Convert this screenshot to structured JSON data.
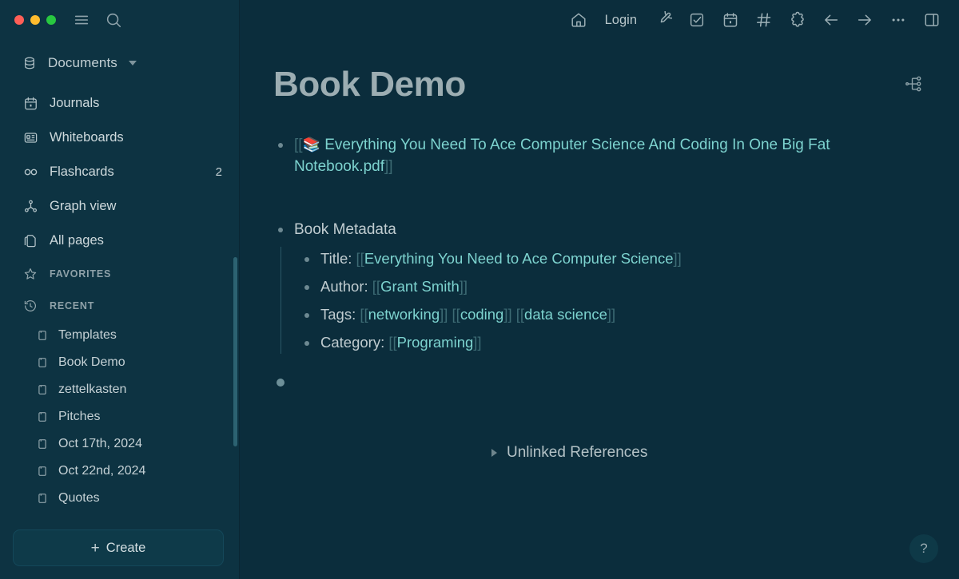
{
  "window": {
    "traffic_lights": [
      {
        "name": "close",
        "color": "#ff5f57"
      },
      {
        "name": "minimize",
        "color": "#febc2e"
      },
      {
        "name": "zoom",
        "color": "#28c840"
      }
    ],
    "menu_icon": "hamburger-menu-icon",
    "search_icon": "search-icon"
  },
  "sidebar": {
    "repo": {
      "icon": "database-icon",
      "label": "Documents",
      "caret": "chevron-down-icon"
    },
    "nav": [
      {
        "icon": "calendar-icon",
        "label": "Journals",
        "count": ""
      },
      {
        "icon": "whiteboard-icon",
        "label": "Whiteboards",
        "count": ""
      },
      {
        "icon": "infinity-icon",
        "label": "Flashcards",
        "count": "2"
      },
      {
        "icon": "graph-view-icon",
        "label": "Graph view",
        "count": ""
      },
      {
        "icon": "copy-pages-icon",
        "label": "All pages",
        "count": ""
      }
    ],
    "favorites": {
      "icon": "star-icon",
      "label": "FAVORITES"
    },
    "recent": {
      "icon": "history-clock-icon",
      "label": "RECENT"
    },
    "recent_pages": [
      {
        "icon": "page-icon",
        "label": "Templates"
      },
      {
        "icon": "page-icon",
        "label": "Book Demo"
      },
      {
        "icon": "page-icon",
        "label": "zettelkasten"
      },
      {
        "icon": "page-icon",
        "label": "Pitches"
      },
      {
        "icon": "page-icon",
        "label": "Oct 17th, 2024"
      },
      {
        "icon": "page-icon",
        "label": "Oct 22nd, 2024"
      },
      {
        "icon": "page-icon",
        "label": "Quotes"
      }
    ],
    "create_button": {
      "plus": "+",
      "label": "Create"
    }
  },
  "toolbar": {
    "home_icon": "home-icon",
    "login_label": "Login",
    "edit_icon": "pencil-circle-icon",
    "todo_icon": "checkbox-icon",
    "calendar_icon": "calendar-icon",
    "tag_icon": "hash-icon",
    "plugin_icon": "puzzle-piece-icon",
    "back_icon": "arrow-left-icon",
    "forward_icon": "arrow-right-icon",
    "more_icon": "ellipsis-icon",
    "sidebar_icon": "right-sidebar-icon"
  },
  "document": {
    "title": "Book Demo",
    "hierarchy_icon": "hierarchy-tree-icon",
    "blocks": [
      {
        "bullet": "small",
        "parts": [
          {
            "t": "brk",
            "text": "[["
          },
          {
            "t": "emoji",
            "text": "📚"
          },
          {
            "t": "ref",
            "text": " Everything You Need To Ace Computer Science And Coding In One Big Fat Notebook.pdf"
          },
          {
            "t": "brk",
            "text": "]]"
          }
        ]
      },
      {
        "bullet": "small",
        "parts": [
          {
            "t": "plain",
            "text": "Book Metadata"
          }
        ],
        "children": [
          {
            "bullet": "small",
            "parts": [
              {
                "t": "plain",
                "text": "Title: "
              },
              {
                "t": "brk",
                "text": "[["
              },
              {
                "t": "ref",
                "text": "Everything You Need to Ace Computer Science"
              },
              {
                "t": "brk",
                "text": "]]"
              }
            ]
          },
          {
            "bullet": "small",
            "parts": [
              {
                "t": "plain",
                "text": "Author: "
              },
              {
                "t": "brk",
                "text": "[["
              },
              {
                "t": "ref",
                "text": "Grant Smith"
              },
              {
                "t": "brk",
                "text": "]]"
              }
            ]
          },
          {
            "bullet": "small",
            "parts": [
              {
                "t": "plain",
                "text": "Tags: "
              },
              {
                "t": "brk",
                "text": "[["
              },
              {
                "t": "ref",
                "text": "networking"
              },
              {
                "t": "brk",
                "text": "]] [["
              },
              {
                "t": "ref",
                "text": "coding"
              },
              {
                "t": "brk",
                "text": "]] [["
              },
              {
                "t": "ref",
                "text": "data science"
              },
              {
                "t": "brk",
                "text": "]]"
              }
            ]
          },
          {
            "bullet": "small",
            "parts": [
              {
                "t": "plain",
                "text": "Category: "
              },
              {
                "t": "brk",
                "text": "[["
              },
              {
                "t": "ref",
                "text": "Programing"
              },
              {
                "t": "brk",
                "text": "]]"
              }
            ]
          }
        ]
      },
      {
        "bullet": "big",
        "parts": []
      }
    ],
    "unlinked_references": {
      "triangle": "triangle-right-icon",
      "label": "Unlinked References"
    },
    "help_button": "?"
  },
  "colors": {
    "sidebar_bg": "#0d3342",
    "main_bg": "#0b2d3c",
    "accent_ref": "#7dd3cf",
    "bracket": "#3d6b74",
    "text": "#c0ccd0",
    "muted": "#8ea1a8"
  }
}
